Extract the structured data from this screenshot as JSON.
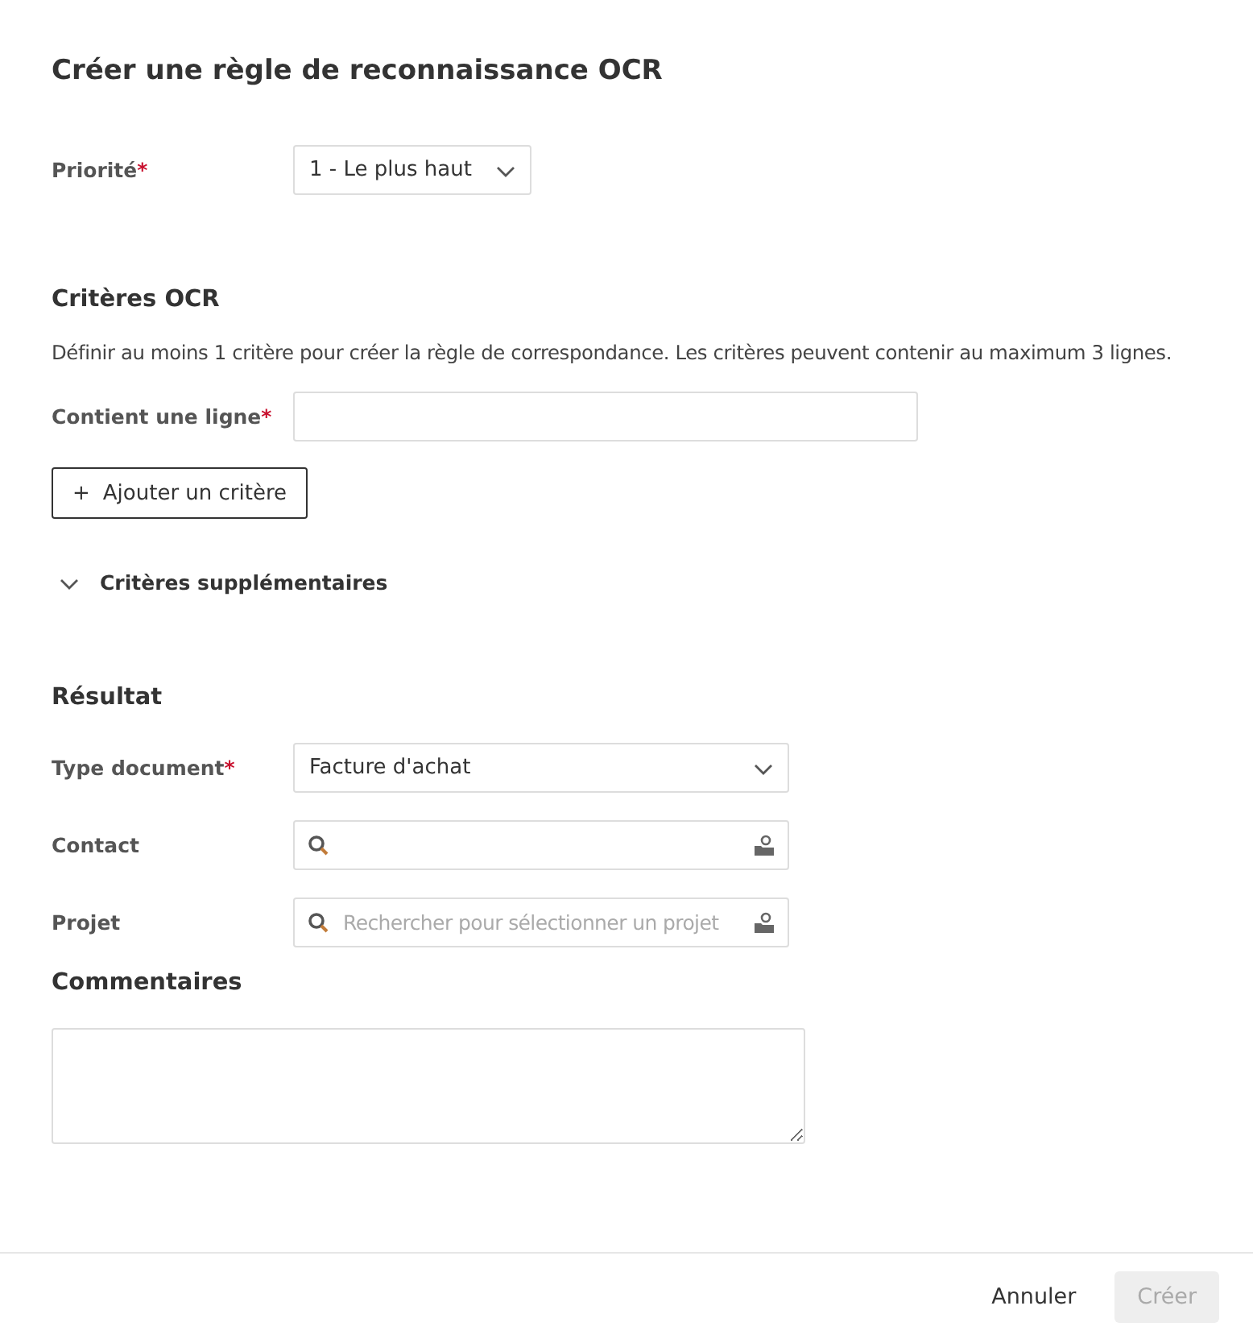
{
  "title": "Créer une règle de reconnaissance OCR",
  "priority": {
    "label": "Priorité",
    "required_mark": "*",
    "value": "1 - Le plus haut"
  },
  "ocr_criteria": {
    "heading": "Critères OCR",
    "description": "Définir au moins 1 critère pour créer la règle de correspondance. Les critères peuvent contenir au maximum 3 lignes.",
    "fields": [
      {
        "label": "Contient une ligne",
        "required_mark": "*"
      }
    ],
    "add_button": {
      "icon": "+",
      "label": "Ajouter un critère"
    },
    "extra": {
      "label": "Critères supplémentaires",
      "expanded": false
    }
  },
  "result": {
    "heading": "Résultat",
    "fields": [
      {
        "kind": "select",
        "label": "Type document",
        "required_mark": "*",
        "value": "Facture d'achat"
      },
      {
        "kind": "search",
        "label": "Contact"
      },
      {
        "kind": "search",
        "label": "Projet",
        "placeholder": "Rechercher pour sélectionner un projet"
      }
    ]
  },
  "comments": {
    "label": "Commentaires"
  },
  "footer": {
    "cancel": "Annuler",
    "submit": {
      "label": "Créer",
      "disabled": true
    }
  }
}
